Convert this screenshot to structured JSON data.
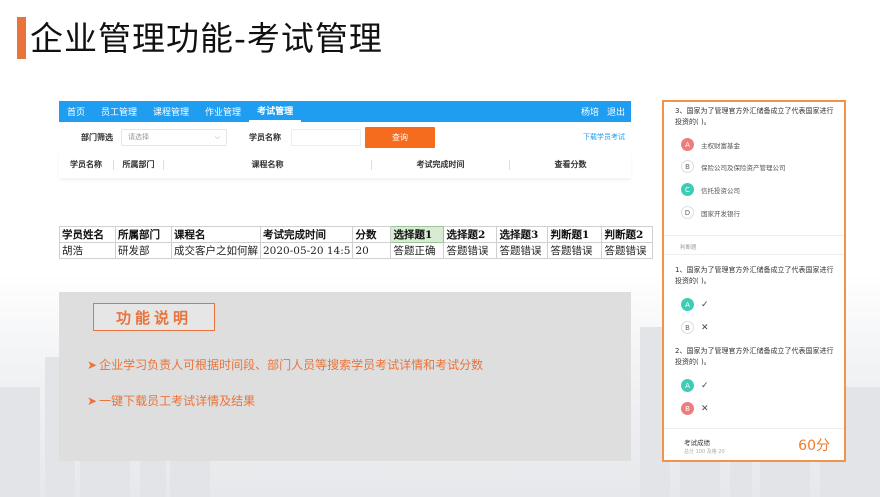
{
  "slide": {
    "title": "企业管理功能-考试管理"
  },
  "nav": {
    "items": [
      "首页",
      "员工管理",
      "课程管理",
      "作业管理",
      "考试管理"
    ],
    "active_index": 4,
    "user": "杨培",
    "logout": "退出"
  },
  "filters": {
    "dept_label": "部门筛选",
    "dept_placeholder": "请选择",
    "student_label": "学员名称",
    "query_button": "查询",
    "download_link": "下载学员考试"
  },
  "list_headers": [
    "学员名称",
    "所属部门",
    "课程名称",
    "考试完成时间",
    "查看分数"
  ],
  "sheet": {
    "headers": [
      "学员姓名",
      "所属部门",
      "课程名",
      "考试完成时间",
      "分数",
      "选择题1",
      "选择题2",
      "选择题3",
      "判断题1",
      "判断题2"
    ],
    "rows": [
      [
        "胡浩",
        "研发部",
        "成交客户之如何解",
        "2020-05-20 14:5",
        "20",
        "答题正确",
        "答题错误",
        "答题错误",
        "答题错误",
        "答题错误"
      ]
    ]
  },
  "description": {
    "title": "功能说明",
    "items": [
      "企业学习负责人可根据时间段、部门人员等搜索学员考试详情和考试分数",
      "一键下载员工考试详情及结果"
    ]
  },
  "phone": {
    "q3_text": "3、国家为了管理官方外汇储备成立了代表国家进行投资的( )。",
    "q3_options": [
      {
        "letter": "A",
        "text": "主权财富基金",
        "state": "wrong"
      },
      {
        "letter": "B",
        "text": "保险公司及保险资产管理公司",
        "state": "none"
      },
      {
        "letter": "C",
        "text": "信托投资公司",
        "state": "correct"
      },
      {
        "letter": "D",
        "text": "国家开发银行",
        "state": "none"
      }
    ],
    "judge_section": "判断题",
    "j1_text": "1、国家为了管理官方外汇储备成立了代表国家进行投资的( )。",
    "j1_options": [
      {
        "letter": "A",
        "mark": "✓",
        "state": "correct"
      },
      {
        "letter": "B",
        "mark": "✕",
        "state": "none"
      }
    ],
    "j2_text": "2、国家为了管理官方外汇储备成立了代表国家进行投资的( )。",
    "j2_options": [
      {
        "letter": "A",
        "mark": "✓",
        "state": "correct"
      },
      {
        "letter": "B",
        "mark": "✕",
        "state": "wrong"
      }
    ],
    "score_label": "考试成绩",
    "score_sub": "总分 100    及格 20",
    "score_value": "60分"
  },
  "colors": {
    "accent": "#e8743b",
    "nav": "#1e9df1",
    "button": "#f56c1e",
    "correct": "#3ecdb4",
    "wrong": "#f07b7b"
  }
}
